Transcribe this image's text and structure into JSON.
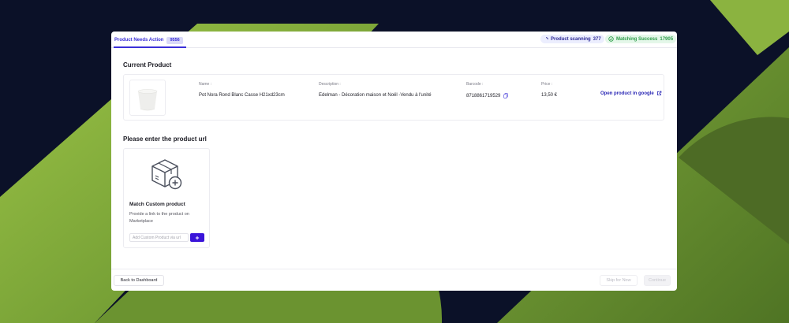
{
  "colors": {
    "accent": "#3b30d8",
    "success": "#2f9d4b",
    "background": "#0b1128",
    "graphic_green": "#7fa93a"
  },
  "header": {
    "tab_label": "Product Needs Action",
    "tab_count": "9556",
    "scanning_label": "Product scanning",
    "scanning_count": "377",
    "matching_label": "Matching Success",
    "matching_count": "17905"
  },
  "current_product": {
    "section_title": "Current Product",
    "name_label": "Name :",
    "name_value": "Pot Nora Rond Blanc Casse H21xd23cm",
    "description_label": "Description :",
    "description_value": "Edelman - Décoration maison et Noël -Vendu à l'unité",
    "barcode_label": "Barcode :",
    "barcode_value": "8718861719529",
    "price_label": "Price :",
    "price_value": "13,50 €",
    "open_link_label": "Open product in google",
    "icons": [
      "copy-icon",
      "external-link-icon"
    ]
  },
  "url_section": {
    "section_title": "Please enter the product url",
    "card_title": "Match Custom product",
    "card_description": "Provide a link to the product on Marketplace",
    "input_placeholder": "Add Custom Product via url",
    "input_value": "",
    "submit_icon": "plus-icon"
  },
  "footer": {
    "back_label": "Back to Dashboard",
    "skip_label": "Skip for Now",
    "continue_label": "Continue"
  }
}
